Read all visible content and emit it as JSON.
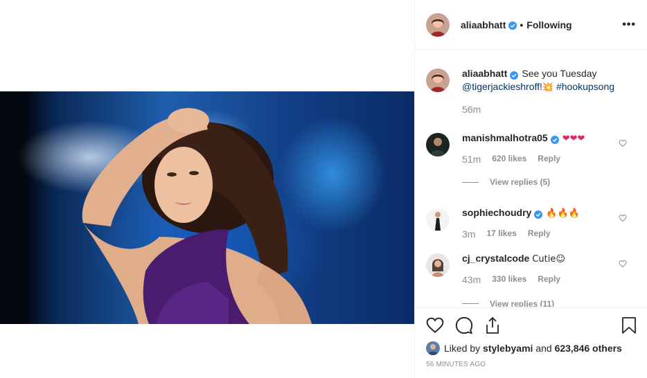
{
  "post": {
    "author": "aliaabhatt",
    "follow_status": "Following",
    "separator": "•",
    "more_label": "•••"
  },
  "caption": {
    "username": "aliaabhatt",
    "text": "See you Tuesday",
    "mention": "@tigerjackieshroff!",
    "emoji": "💥",
    "hashtag": "#hookupsong",
    "time": "56m"
  },
  "comments": [
    {
      "username": "manishmalhotra05",
      "text": "❤❤❤",
      "time": "51m",
      "likes": "620 likes",
      "reply": "Reply",
      "verified": true
    },
    {
      "username": "sophiechoudry",
      "text": "🔥🔥🔥",
      "time": "3m",
      "likes": "17 likes",
      "reply": "Reply",
      "verified": true
    },
    {
      "username": "cj_crystalcode",
      "text": "Cutie☺",
      "time": "43m",
      "likes": "330 likes",
      "reply": "Reply",
      "verified": false
    }
  ],
  "view_replies": {
    "label": "View replies (5)"
  },
  "partial_replies": {
    "label": "View replies (11)"
  },
  "liked_by": {
    "prefix": "Liked by",
    "user": "stylebyami",
    "conjunction": "and",
    "others": "623,846 others"
  },
  "timestamp": "56 MINUTES AGO",
  "icons": {
    "like": "heart-icon",
    "comment": "comment-bubble-icon",
    "share": "share-icon",
    "save": "bookmark-icon",
    "verified": "verified-badge-icon"
  },
  "colors": {
    "verified_blue": "#3897f0",
    "link_blue": "#003569",
    "secondary_text": "#8e8e8e",
    "border": "#efefef"
  }
}
